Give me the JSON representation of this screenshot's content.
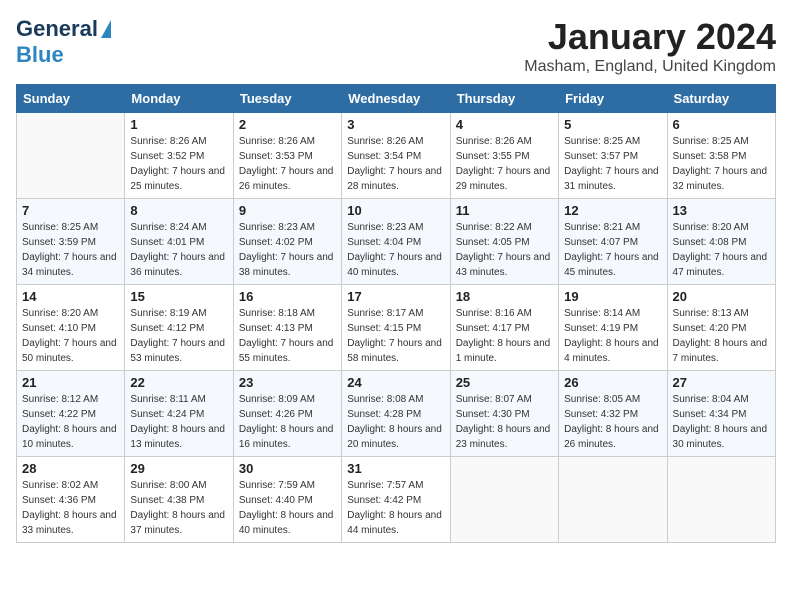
{
  "header": {
    "logo_line1": "General",
    "logo_line2": "Blue",
    "month": "January 2024",
    "location": "Masham, England, United Kingdom"
  },
  "weekdays": [
    "Sunday",
    "Monday",
    "Tuesday",
    "Wednesday",
    "Thursday",
    "Friday",
    "Saturday"
  ],
  "weeks": [
    [
      {
        "day": "",
        "sunrise": "",
        "sunset": "",
        "daylight": ""
      },
      {
        "day": "1",
        "sunrise": "Sunrise: 8:26 AM",
        "sunset": "Sunset: 3:52 PM",
        "daylight": "Daylight: 7 hours and 25 minutes."
      },
      {
        "day": "2",
        "sunrise": "Sunrise: 8:26 AM",
        "sunset": "Sunset: 3:53 PM",
        "daylight": "Daylight: 7 hours and 26 minutes."
      },
      {
        "day": "3",
        "sunrise": "Sunrise: 8:26 AM",
        "sunset": "Sunset: 3:54 PM",
        "daylight": "Daylight: 7 hours and 28 minutes."
      },
      {
        "day": "4",
        "sunrise": "Sunrise: 8:26 AM",
        "sunset": "Sunset: 3:55 PM",
        "daylight": "Daylight: 7 hours and 29 minutes."
      },
      {
        "day": "5",
        "sunrise": "Sunrise: 8:25 AM",
        "sunset": "Sunset: 3:57 PM",
        "daylight": "Daylight: 7 hours and 31 minutes."
      },
      {
        "day": "6",
        "sunrise": "Sunrise: 8:25 AM",
        "sunset": "Sunset: 3:58 PM",
        "daylight": "Daylight: 7 hours and 32 minutes."
      }
    ],
    [
      {
        "day": "7",
        "sunrise": "Sunrise: 8:25 AM",
        "sunset": "Sunset: 3:59 PM",
        "daylight": "Daylight: 7 hours and 34 minutes."
      },
      {
        "day": "8",
        "sunrise": "Sunrise: 8:24 AM",
        "sunset": "Sunset: 4:01 PM",
        "daylight": "Daylight: 7 hours and 36 minutes."
      },
      {
        "day": "9",
        "sunrise": "Sunrise: 8:23 AM",
        "sunset": "Sunset: 4:02 PM",
        "daylight": "Daylight: 7 hours and 38 minutes."
      },
      {
        "day": "10",
        "sunrise": "Sunrise: 8:23 AM",
        "sunset": "Sunset: 4:04 PM",
        "daylight": "Daylight: 7 hours and 40 minutes."
      },
      {
        "day": "11",
        "sunrise": "Sunrise: 8:22 AM",
        "sunset": "Sunset: 4:05 PM",
        "daylight": "Daylight: 7 hours and 43 minutes."
      },
      {
        "day": "12",
        "sunrise": "Sunrise: 8:21 AM",
        "sunset": "Sunset: 4:07 PM",
        "daylight": "Daylight: 7 hours and 45 minutes."
      },
      {
        "day": "13",
        "sunrise": "Sunrise: 8:20 AM",
        "sunset": "Sunset: 4:08 PM",
        "daylight": "Daylight: 7 hours and 47 minutes."
      }
    ],
    [
      {
        "day": "14",
        "sunrise": "Sunrise: 8:20 AM",
        "sunset": "Sunset: 4:10 PM",
        "daylight": "Daylight: 7 hours and 50 minutes."
      },
      {
        "day": "15",
        "sunrise": "Sunrise: 8:19 AM",
        "sunset": "Sunset: 4:12 PM",
        "daylight": "Daylight: 7 hours and 53 minutes."
      },
      {
        "day": "16",
        "sunrise": "Sunrise: 8:18 AM",
        "sunset": "Sunset: 4:13 PM",
        "daylight": "Daylight: 7 hours and 55 minutes."
      },
      {
        "day": "17",
        "sunrise": "Sunrise: 8:17 AM",
        "sunset": "Sunset: 4:15 PM",
        "daylight": "Daylight: 7 hours and 58 minutes."
      },
      {
        "day": "18",
        "sunrise": "Sunrise: 8:16 AM",
        "sunset": "Sunset: 4:17 PM",
        "daylight": "Daylight: 8 hours and 1 minute."
      },
      {
        "day": "19",
        "sunrise": "Sunrise: 8:14 AM",
        "sunset": "Sunset: 4:19 PM",
        "daylight": "Daylight: 8 hours and 4 minutes."
      },
      {
        "day": "20",
        "sunrise": "Sunrise: 8:13 AM",
        "sunset": "Sunset: 4:20 PM",
        "daylight": "Daylight: 8 hours and 7 minutes."
      }
    ],
    [
      {
        "day": "21",
        "sunrise": "Sunrise: 8:12 AM",
        "sunset": "Sunset: 4:22 PM",
        "daylight": "Daylight: 8 hours and 10 minutes."
      },
      {
        "day": "22",
        "sunrise": "Sunrise: 8:11 AM",
        "sunset": "Sunset: 4:24 PM",
        "daylight": "Daylight: 8 hours and 13 minutes."
      },
      {
        "day": "23",
        "sunrise": "Sunrise: 8:09 AM",
        "sunset": "Sunset: 4:26 PM",
        "daylight": "Daylight: 8 hours and 16 minutes."
      },
      {
        "day": "24",
        "sunrise": "Sunrise: 8:08 AM",
        "sunset": "Sunset: 4:28 PM",
        "daylight": "Daylight: 8 hours and 20 minutes."
      },
      {
        "day": "25",
        "sunrise": "Sunrise: 8:07 AM",
        "sunset": "Sunset: 4:30 PM",
        "daylight": "Daylight: 8 hours and 23 minutes."
      },
      {
        "day": "26",
        "sunrise": "Sunrise: 8:05 AM",
        "sunset": "Sunset: 4:32 PM",
        "daylight": "Daylight: 8 hours and 26 minutes."
      },
      {
        "day": "27",
        "sunrise": "Sunrise: 8:04 AM",
        "sunset": "Sunset: 4:34 PM",
        "daylight": "Daylight: 8 hours and 30 minutes."
      }
    ],
    [
      {
        "day": "28",
        "sunrise": "Sunrise: 8:02 AM",
        "sunset": "Sunset: 4:36 PM",
        "daylight": "Daylight: 8 hours and 33 minutes."
      },
      {
        "day": "29",
        "sunrise": "Sunrise: 8:00 AM",
        "sunset": "Sunset: 4:38 PM",
        "daylight": "Daylight: 8 hours and 37 minutes."
      },
      {
        "day": "30",
        "sunrise": "Sunrise: 7:59 AM",
        "sunset": "Sunset: 4:40 PM",
        "daylight": "Daylight: 8 hours and 40 minutes."
      },
      {
        "day": "31",
        "sunrise": "Sunrise: 7:57 AM",
        "sunset": "Sunset: 4:42 PM",
        "daylight": "Daylight: 8 hours and 44 minutes."
      },
      {
        "day": "",
        "sunrise": "",
        "sunset": "",
        "daylight": ""
      },
      {
        "day": "",
        "sunrise": "",
        "sunset": "",
        "daylight": ""
      },
      {
        "day": "",
        "sunrise": "",
        "sunset": "",
        "daylight": ""
      }
    ]
  ]
}
